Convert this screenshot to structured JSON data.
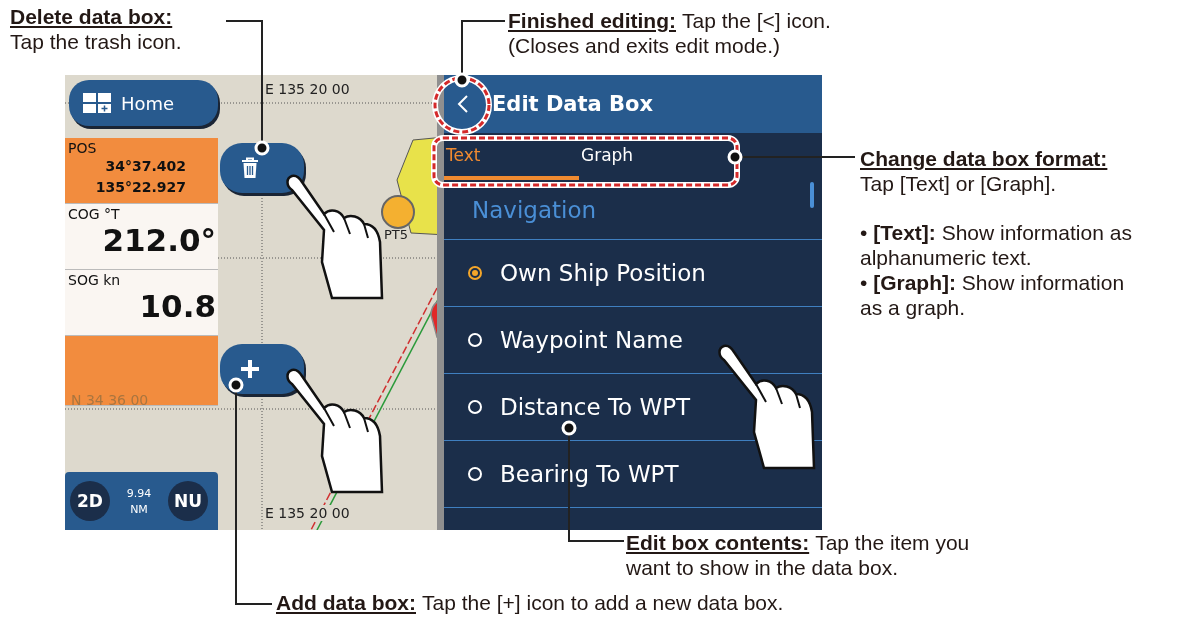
{
  "callouts": [
    {
      "kind": "delete",
      "heading": "Delete data box:",
      "lines": [
        "Tap the trash icon."
      ]
    },
    {
      "kind": "finish",
      "heading": "Finished editing:",
      "inline": "Tap the [<] icon.",
      "lines": [
        "(Closes and exits edit mode.)"
      ]
    },
    {
      "kind": "format",
      "heading": "Change data box format:",
      "lines": [
        "Tap [Text] or [Graph]."
      ],
      "bullets": [
        "• **[Text]:** Show information as alphanumeric text.",
        "• **[Graph]:** Show information as a graph."
      ]
    },
    {
      "kind": "contents",
      "heading": "Edit box contents:",
      "inline": "Tap the item you",
      "lines": [
        "want to show in the data box."
      ]
    },
    {
      "kind": "add",
      "heading": "Add data box:",
      "inline": "Tap the [+] icon to add a new data box."
    }
  ],
  "screen": {
    "home_button": "Home",
    "map": {
      "grid_labels": [
        "E 135 20 00",
        "N 34 36 00",
        "E 135 20 00"
      ],
      "waypoint": "PT5"
    },
    "data_boxes": [
      {
        "label": "POS",
        "values": [
          "34°37.402",
          "135°22.927"
        ],
        "selected": true
      },
      {
        "label": "COG °T",
        "values": [
          "212.0°"
        ],
        "selected": false
      },
      {
        "label": "SOG kn",
        "values": [
          "10.8"
        ],
        "selected": false
      },
      {
        "selected": true
      }
    ],
    "bottom_bar": {
      "mode": "2D",
      "range": "9.94",
      "unit": "NM",
      "orientation": "NU"
    },
    "panel": {
      "title": "Edit Data Box",
      "tabs": [
        {
          "label": "Text",
          "selected": true
        },
        {
          "label": "Graph",
          "selected": false
        }
      ],
      "category": "Navigation",
      "items": [
        {
          "label": "Own Ship Position",
          "selected": true
        },
        {
          "label": "Waypoint Name",
          "selected": false
        },
        {
          "label": "Distance To WPT",
          "selected": false
        },
        {
          "label": "Bearing To WPT",
          "selected": false
        }
      ]
    }
  }
}
